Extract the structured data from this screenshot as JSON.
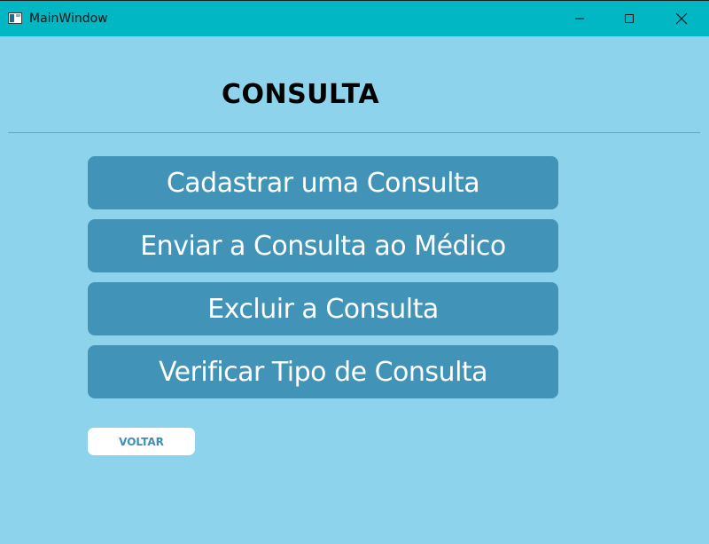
{
  "window": {
    "title": "MainWindow",
    "controls": {
      "minimize_icon": "minimize-icon",
      "maximize_icon": "maximize-icon",
      "close_icon": "close-icon"
    }
  },
  "colors": {
    "titlebar": "#00b7c3",
    "background": "#8dd3ec",
    "button": "#4194b8",
    "back_button": "#ffffff",
    "back_button_text": "#3d8fb5"
  },
  "main": {
    "title": "CONSULTA",
    "buttons": [
      {
        "label": "Cadastrar uma Consulta"
      },
      {
        "label": "Enviar a Consulta ao Médico"
      },
      {
        "label": "Excluir a Consulta"
      },
      {
        "label": "Verificar Tipo de Consulta"
      }
    ],
    "back_label": "VOLTAR"
  }
}
